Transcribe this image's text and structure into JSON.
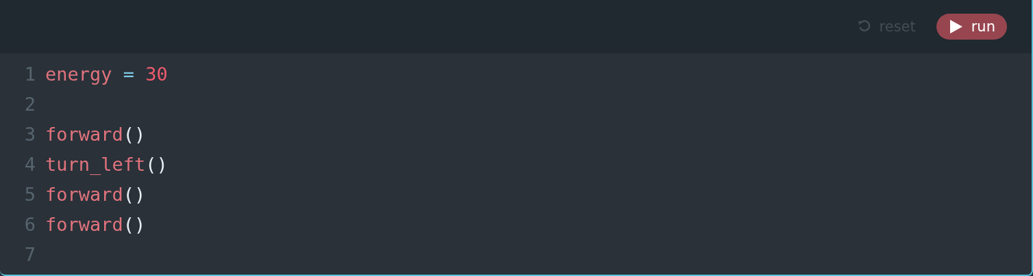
{
  "toolbar": {
    "buttons": [
      {
        "kind": "reset",
        "label": "reset",
        "disabled": true
      },
      {
        "kind": "run",
        "label": "run",
        "disabled": false
      }
    ]
  },
  "editor": {
    "lines": [
      {
        "number": "1",
        "tokens": [
          {
            "kind": "name",
            "text": "energy"
          },
          {
            "kind": "op",
            "text": "="
          },
          {
            "kind": "number",
            "text": "30"
          }
        ]
      },
      {
        "number": "2"
      },
      {
        "number": "3",
        "tokens": [
          {
            "kind": "name",
            "text": "forward"
          },
          {
            "kind": "punct",
            "text": "()"
          }
        ]
      },
      {
        "number": "4",
        "tokens": [
          {
            "kind": "name",
            "text": "turn_left"
          },
          {
            "kind": "punct",
            "text": "()"
          }
        ]
      },
      {
        "number": "5",
        "tokens": [
          {
            "kind": "name",
            "text": "forward"
          },
          {
            "kind": "punct",
            "text": "()"
          }
        ]
      },
      {
        "number": "6",
        "tokens": [
          {
            "kind": "name",
            "text": "forward"
          },
          {
            "kind": "punct",
            "text": "()"
          }
        ]
      },
      {
        "number": "7"
      }
    ]
  }
}
